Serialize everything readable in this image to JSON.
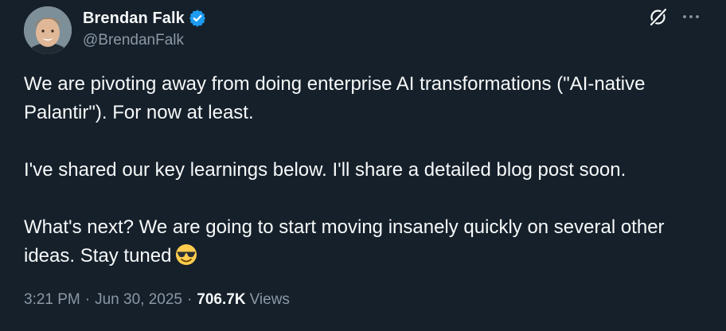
{
  "author": {
    "display_name": "Brendan Falk",
    "handle": "@BrendanFalk",
    "verified": true
  },
  "icons": {
    "verified": "verified-badge-icon",
    "grok": "grok-icon",
    "more": "more-options-icon",
    "emoji": "smiling-face-with-sunglasses"
  },
  "tweet": {
    "paragraph_1": "We are pivoting away from doing enterprise AI transformations (\"AI-native Palantir\"). For now at least.",
    "paragraph_2": "I've shared our key learnings below. I'll share a detailed blog post soon.",
    "paragraph_3": "What's next? We are going to start moving insanely quickly on several other ideas. Stay tuned",
    "emoji": "😎"
  },
  "meta": {
    "time": "3:21 PM",
    "separator": "·",
    "date": "Jun 30, 2025",
    "views_count": "706.7K",
    "views_label": "Views"
  },
  "colors": {
    "background": "#15202b",
    "text_primary": "#f7f9f9",
    "text_secondary": "#8b98a5",
    "verified_blue": "#1d9bf0"
  }
}
